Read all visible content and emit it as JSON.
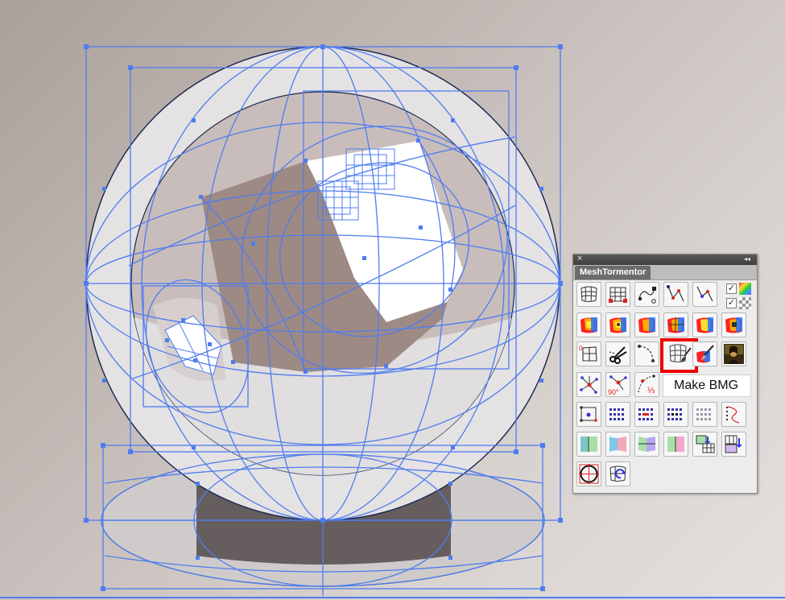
{
  "panel": {
    "title": "MeshTormentor",
    "close_glyph": "×",
    "collapse_glyph": "◂◂",
    "checkbox_mark": "✓",
    "tooltip": "Make BMG",
    "label_angle": "90°",
    "label_third": "⅓",
    "label_zero": "0",
    "selected_tool": "make-bmg",
    "accent_color": "#ee0000",
    "tools": [
      [
        "grid-warp-icon",
        "grid-handles-icon",
        "path-node-icon",
        "node-path-red-icon",
        "node-path-blue-icon",
        "color-swatch-options"
      ],
      [
        "warp-color-1-icon",
        "warp-color-2-icon",
        "warp-color-3-icon",
        "warp-color-4-icon",
        "warp-color-5-icon",
        "warp-color-6-icon"
      ],
      [
        "grid-zero-icon",
        "scissors-icon",
        "dashed-curve-icon",
        "make-bmg-icon",
        "brush-warp-icon",
        "mona-lisa-icon"
      ],
      [
        "node-star-icon",
        "rotate-90-icon",
        "curve-third-icon"
      ],
      [
        "nodes-connect-icon",
        "dot-grid-1-icon",
        "dot-grid-2-icon",
        "dot-grid-3-icon",
        "dot-grid-4-icon",
        "dotted-curve-icon"
      ],
      [
        "gradient-patch-1-icon",
        "gradient-patch-2-icon",
        "gradient-patch-3-icon",
        "gradient-patch-4-icon",
        "grid-arrow-1-icon",
        "grid-arrow-2-icon"
      ],
      [
        "circle-target-icon",
        "rotate-warp-icon"
      ]
    ]
  },
  "canvas": {
    "background": "#b6aca8",
    "guide_color": "#4f7cf0"
  }
}
